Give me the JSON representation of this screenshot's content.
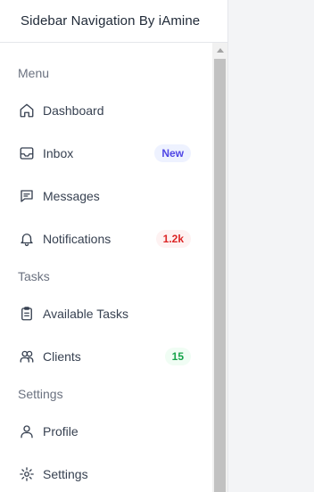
{
  "app": {
    "title": "Sidebar Navigation By iAmine"
  },
  "sections": [
    {
      "label": "Menu"
    },
    {
      "label": "Tasks"
    },
    {
      "label": "Settings"
    }
  ],
  "items": [
    {
      "label": "Dashboard",
      "icon": "home-icon"
    },
    {
      "label": "Inbox",
      "icon": "inbox-icon",
      "badge": "New",
      "badge_color": "#4f46e5",
      "badge_bg": "#eef2ff"
    },
    {
      "label": "Messages",
      "icon": "message-icon"
    },
    {
      "label": "Notifications",
      "icon": "bell-icon",
      "badge": "1.2k",
      "badge_color": "#dc2626",
      "badge_bg": "#fef2f2"
    },
    {
      "label": "Available Tasks",
      "icon": "clipboard-icon"
    },
    {
      "label": "Clients",
      "icon": "users-icon",
      "badge": "15",
      "badge_color": "#16a34a",
      "badge_bg": "#f0fdf4"
    },
    {
      "label": "Profile",
      "icon": "user-icon"
    },
    {
      "label": "Settings",
      "icon": "gear-icon"
    }
  ]
}
